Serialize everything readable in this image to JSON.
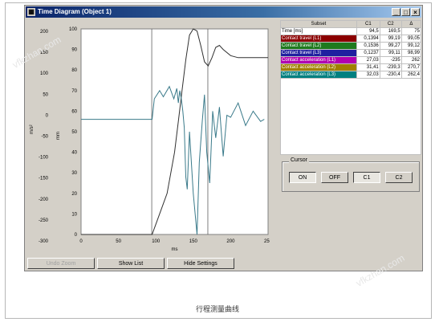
{
  "window": {
    "title": "Time Diagram (Object 1)"
  },
  "chart_data": {
    "type": "line",
    "xlabel": "ms",
    "x_ticks": [
      "0",
      "50",
      "100",
      "150",
      "200",
      "250"
    ],
    "y_left_ticks": [
      "200",
      "150",
      "100",
      "50",
      "0",
      "-50",
      "-100",
      "-150",
      "-200",
      "-250",
      "-300"
    ],
    "y_left_unit": "m/s²",
    "y_mid_ticks": [
      "100",
      "90",
      "80",
      "70",
      "60",
      "50",
      "40",
      "30",
      "20",
      "10",
      "0"
    ],
    "y_mid_unit": "mm",
    "xlim": [
      0,
      250
    ],
    "series": [
      {
        "color": "#303030",
        "x": [
          0,
          95,
          100,
          115,
          125,
          130,
          135,
          140,
          145,
          150,
          155,
          160,
          165,
          170,
          175,
          180,
          185,
          190,
          200,
          210,
          220,
          230,
          250
        ],
        "y": [
          0,
          0,
          5,
          20,
          40,
          55,
          70,
          85,
          97,
          100,
          99,
          92,
          84,
          82,
          86,
          91,
          92,
          90,
          87,
          86,
          86,
          86,
          86
        ]
      },
      {
        "color": "#3a7a8a",
        "x": [
          0,
          95,
          98,
          105,
          110,
          118,
          124,
          128,
          130,
          132,
          134,
          136,
          138,
          140,
          142,
          145,
          150,
          155,
          158,
          162,
          165,
          168,
          172,
          176,
          180,
          185,
          190,
          195,
          200,
          210,
          220,
          230,
          240,
          245
        ],
        "y": [
          56,
          56,
          66,
          70,
          67,
          72,
          66,
          71,
          64,
          70,
          66,
          60,
          52,
          28,
          22,
          50,
          20,
          0,
          35,
          55,
          68,
          40,
          25,
          60,
          47,
          62,
          38,
          58,
          57,
          64,
          53,
          60,
          55,
          56
        ]
      }
    ],
    "cursor_lines_ms": [
      94.5,
      169.5
    ]
  },
  "subset_table": {
    "headers": [
      "Subset",
      "C1",
      "C2",
      "Δ"
    ],
    "rows": [
      {
        "name": "Time [ms]",
        "c1": "94,5",
        "c2": "169,5",
        "delta": "75",
        "color": "#ffffff"
      },
      {
        "name": "Contact travel (L1)",
        "c1": "0,1394",
        "c2": "99,19",
        "delta": "99,05",
        "color": "#8b0000"
      },
      {
        "name": "Contact travel (L2)",
        "c1": "0,1536",
        "c2": "99,27",
        "delta": "99,12",
        "color": "#1e7a1e"
      },
      {
        "name": "Contact travel (L3)",
        "c1": "0,1237",
        "c2": "99,11",
        "delta": "98,99",
        "color": "#2020a0"
      },
      {
        "name": "Contact acceleration (L1)",
        "c1": "27,03",
        "c2": "-235",
        "delta": "262",
        "color": "#b000b0"
      },
      {
        "name": "Contact acceleration (L2)",
        "c1": "31,41",
        "c2": "-239,3",
        "delta": "270,7",
        "color": "#a08000"
      },
      {
        "name": "Contact acceleration (L3)",
        "c1": "32,03",
        "c2": "-230,4",
        "delta": "262,4",
        "color": "#008080"
      }
    ]
  },
  "cursor": {
    "legend": "Cursor",
    "on": "ON",
    "off": "OFF",
    "c1": "C1",
    "c2": "C2"
  },
  "buttons": {
    "undo_zoom": "Undo Zoom",
    "show_list": "Show List",
    "hide_settings": "Hide Settings"
  },
  "caption": "行程测量曲线",
  "watermark": "vfkzhan.com"
}
